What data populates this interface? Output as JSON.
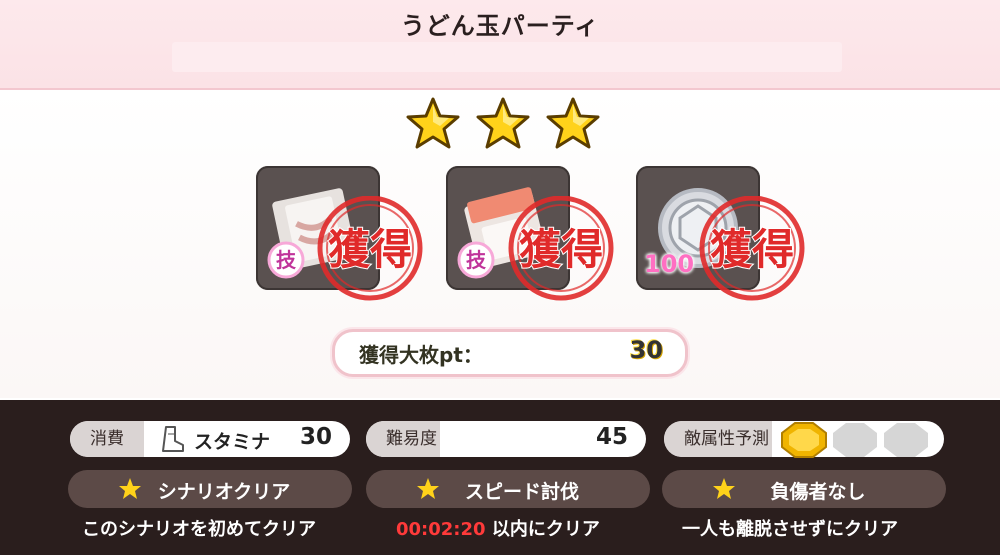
{
  "header": {
    "title": "うどん玉パーティ"
  },
  "rating": {
    "stars_earned": 3,
    "stars_total": 3
  },
  "rewards": [
    {
      "icon": "skill-book-icon",
      "qty": "",
      "badge": "技",
      "stamp": "獲得"
    },
    {
      "icon": "skill-book-icon",
      "qty": "",
      "badge": "技",
      "stamp": "獲得"
    },
    {
      "icon": "silver-coin-icon",
      "qty": "100",
      "badge": "",
      "stamp": "獲得"
    }
  ],
  "points": {
    "label": "獲得大枚pt：",
    "value": "30"
  },
  "stats": {
    "stamina": {
      "key": "消費",
      "label": "スタミナ",
      "value": "30"
    },
    "difficulty": {
      "key": "難易度",
      "value": "45"
    },
    "enemy": {
      "key": "敵属性予測",
      "slots": [
        "gold",
        "empty",
        "empty"
      ]
    }
  },
  "conditions": [
    {
      "label": "シナリオクリア",
      "desc": "このシナリオを初めてクリア"
    },
    {
      "label": "スピード討伐",
      "timer": "00:02:20",
      "desc": "以内にクリア"
    },
    {
      "label": "負傷者なし",
      "desc": "一人も離脱させずにクリア"
    }
  ],
  "colors": {
    "star": "#ffd21a",
    "stamp": "#e02a2a",
    "timer": "#ff3a3a"
  }
}
